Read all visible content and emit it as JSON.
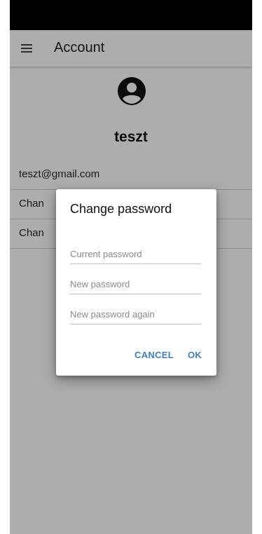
{
  "app_bar": {
    "title": "Account",
    "menu_icon": "hamburger-menu-icon"
  },
  "profile": {
    "avatar_icon": "account-circle-icon",
    "username": "teszt",
    "email": "teszt@gmail.com",
    "row2_label": "Chan",
    "row3_label": "Chan"
  },
  "dialog": {
    "title": "Change password",
    "current_password_placeholder": "Current password",
    "new_password_placeholder": "New password",
    "new_password_again_placeholder": "New password again",
    "cancel_label": "CANCEL",
    "ok_label": "OK"
  },
  "colors": {
    "status_bar": "#000000",
    "accent": "#3f7fbf",
    "scrim": "rgba(0,0,0,0.32)"
  }
}
